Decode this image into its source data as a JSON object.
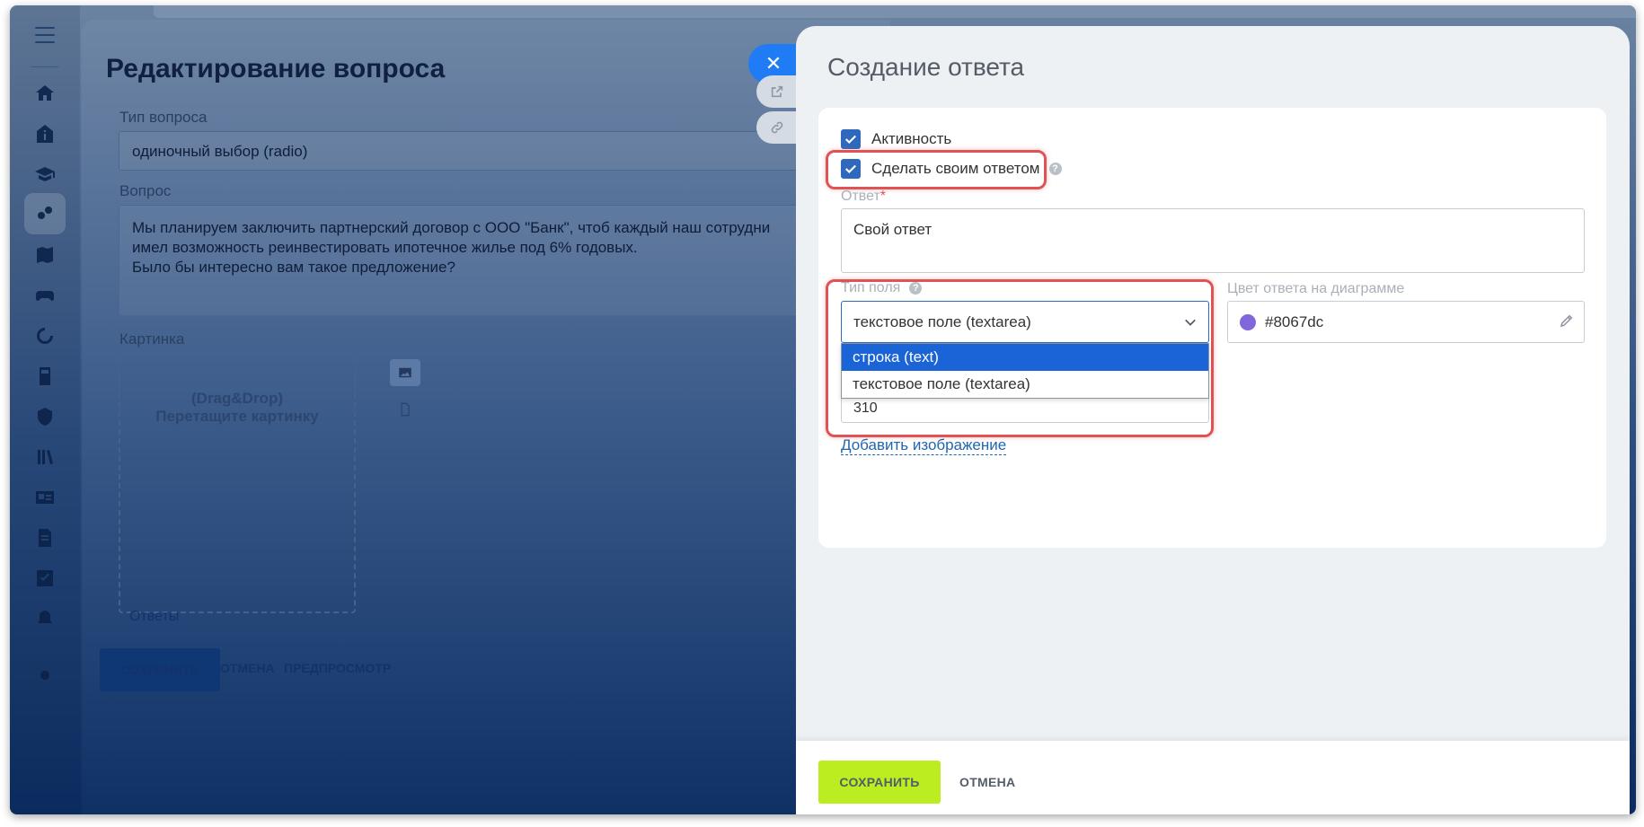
{
  "background_editor": {
    "title": "Редактирование вопроса",
    "question_type_label": "Тип вопроса",
    "question_type_value": "одиночный выбор (radio)",
    "question_label": "Вопрос",
    "question_text": "Мы планируем заключить партнерский договор с ООО \"Банк\", чтоб каждый наш сотрудни\nимел возможность реинвестировать ипотечное жилье под 6% годовых.\nБыло бы интересно вам такое предложение?",
    "image_label": "Картинка",
    "dropzone_line1": "(Drag&Drop)",
    "dropzone_line2": "Перетащите картинку",
    "answers_label": "Ответы",
    "save_button": "СОХРАНИТЬ",
    "cancel_button": "ОТМЕНА",
    "preview_button": "ПРЕДПРОСМОТР"
  },
  "answer_slider": {
    "title": "Создание ответа",
    "active_label": "Активность",
    "active_checked": true,
    "own_answer_label": "Сделать своим ответом",
    "own_answer_checked": true,
    "answer_label": "Ответ",
    "answer_required_mark": "*",
    "answer_value": "Свой ответ",
    "field_type_label": "Тип поля",
    "field_type_value": "текстовое поле (textarea)",
    "field_type_options": [
      "строка (text)",
      "текстовое поле (textarea)"
    ],
    "field_type_highlighted": "строка (text)",
    "hidden_input_value": "310",
    "color_label": "Цвет ответа на диаграмме",
    "color_value": "#8067dc",
    "add_image_link": "Добавить изображение",
    "save_button": "СОХРАНИТЬ",
    "cancel_button": "ОТМЕНА"
  },
  "colors": {
    "accent_blue": "#2f69bd",
    "save_green": "#bbed21",
    "highlight_red": "#e05354",
    "answer_color": "#8067dc"
  }
}
